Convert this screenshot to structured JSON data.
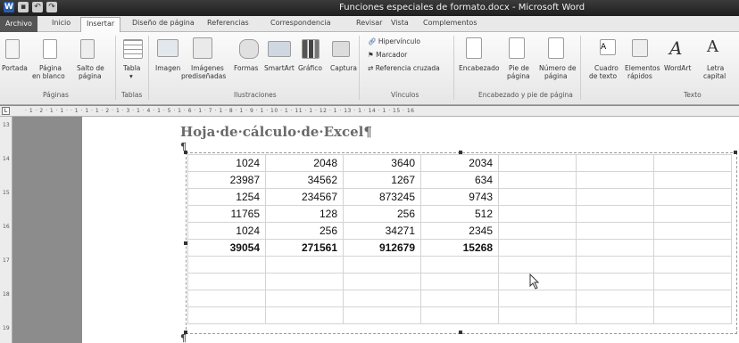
{
  "window": {
    "title": "Funciones especiales de formato.docx - Microsoft Word"
  },
  "tabs": [
    "Archivo",
    "Inicio",
    "Insertar",
    "Diseño de página",
    "Referencias",
    "Correspondencia",
    "Revisar",
    "Vista",
    "Complementos"
  ],
  "ribbon": {
    "paginas": {
      "portada": "Portada",
      "pagina_blanco_1": "Página",
      "pagina_blanco_2": "en blanco",
      "salto_1": "Salto de",
      "salto_2": "página",
      "group": "Páginas"
    },
    "tablas": {
      "tabla": "Tabla",
      "group": "Tablas"
    },
    "ilustraciones": {
      "imagen": "Imagen",
      "predis_1": "Imágenes",
      "predis_2": "prediseñadas",
      "formas": "Formas",
      "smartart": "SmartArt",
      "grafico": "Gráfico",
      "captura": "Captura",
      "group": "Ilustraciones"
    },
    "vinculos": {
      "hipervinculo": "Hipervínculo",
      "marcador": "Marcador",
      "referencia": "Referencia cruzada",
      "group": "Vínculos"
    },
    "encabezado": {
      "encabezado": "Encabezado",
      "pie_1": "Pie de",
      "pie_2": "página",
      "numero_1": "Número de",
      "numero_2": "página",
      "group": "Encabezado y pie de página"
    },
    "texto": {
      "cuadro_1": "Cuadro",
      "cuadro_2": "de texto",
      "elementos_1": "Elementos",
      "elementos_2": "rápidos",
      "wordart": "WordArt",
      "letra_1": "Letra",
      "letra_2": "capital",
      "group": "Texto"
    }
  },
  "ruler": {
    "ticks": "· 1 · 2 · 1 · 1 ·   · 1 · 1 · 1 · 2 · 1 · 3 · 1 · 4 · 1 · 5 · 1 · 6 · 1 · 7 · 1 · 8 · 1 · 9 · 1 · 10 · 1 · 11 · 1 · 12 · 1 · 13 · 1 · 14 · 1 · 15 · 16"
  },
  "vruler": [
    "13",
    "14",
    "15",
    "16",
    "17",
    "18",
    "19"
  ],
  "document": {
    "heading": "Hoja·de·cálculo·de·Excel¶",
    "pilcrow": "¶",
    "rows": [
      [
        "1024",
        "2048",
        "3640",
        "2034",
        "",
        "",
        ""
      ],
      [
        "23987",
        "34562",
        "1267",
        "634",
        "",
        "",
        ""
      ],
      [
        "1254",
        "234567",
        "873245",
        "9743",
        "",
        "",
        ""
      ],
      [
        "11765",
        "128",
        "256",
        "512",
        "",
        "",
        ""
      ],
      [
        "1024",
        "256",
        "34271",
        "2345",
        "",
        "",
        ""
      ],
      [
        "39054",
        "271561",
        "912679",
        "15268",
        "",
        "",
        ""
      ],
      [
        "",
        "",
        "",
        "",
        "",
        "",
        ""
      ],
      [
        "",
        "",
        "",
        "",
        "",
        "",
        ""
      ],
      [
        "",
        "",
        "",
        "",
        "",
        "",
        ""
      ],
      [
        "",
        "",
        "",
        "",
        "",
        "",
        ""
      ]
    ],
    "total_row_index": 5
  }
}
